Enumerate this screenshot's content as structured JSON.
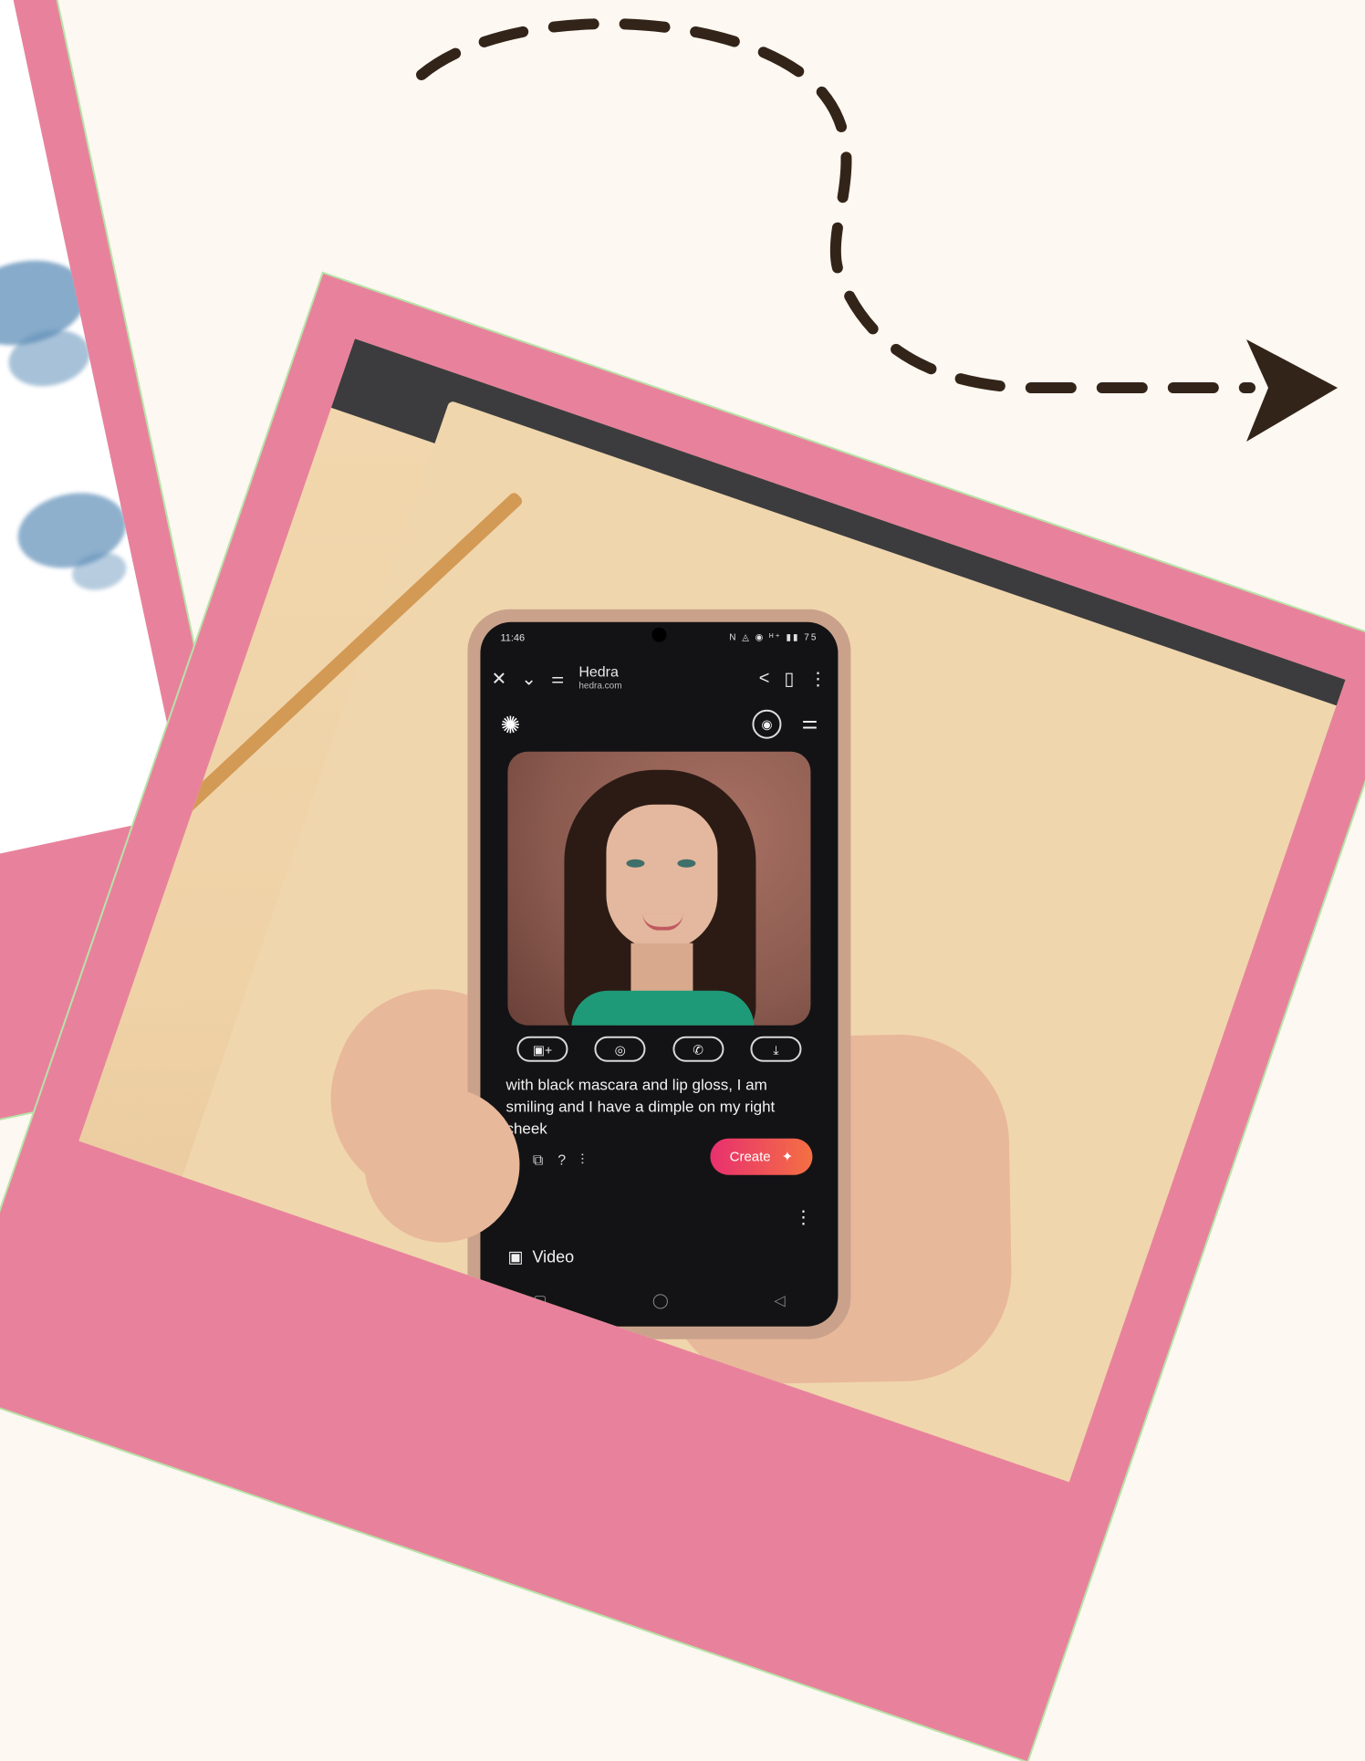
{
  "phone": {
    "status": {
      "time": "11:46",
      "icons": "N ◬ ◉ ᴴ⁺ ▮▮ 75"
    },
    "browser": {
      "site_name": "Hedra",
      "site_url": "hedra.com",
      "close_glyph": "✕",
      "chevron_glyph": "⌄",
      "tune_glyph": "⚌",
      "share_glyph": "<",
      "bookmark_glyph": "▯",
      "more_glyph": "⋮"
    },
    "app": {
      "logo_glyph": "✺",
      "profile_glyph": "◉",
      "menu_glyph": "⚌",
      "actions": [
        "▣+",
        "◎",
        "✆",
        "⤓"
      ],
      "prompt_text": "with black mascara and lip gloss, I am smiling and I have a dimple on my right cheek",
      "tools": [
        "↻",
        "⧉",
        "?",
        "⫶"
      ],
      "create_label": "Create",
      "create_icon": "✦",
      "more_glyph": "⋮",
      "video_icon": "▣",
      "video_label": "Video",
      "nav": [
        "▢",
        "◯",
        "◁"
      ]
    }
  },
  "colors": {
    "background": "#fdf8f1",
    "polaroid": "#e8829c",
    "polaroid_edge": "#b7e3a8",
    "arrow": "#33241a",
    "create_button_start": "#e8306f",
    "create_button_end": "#f47043"
  }
}
